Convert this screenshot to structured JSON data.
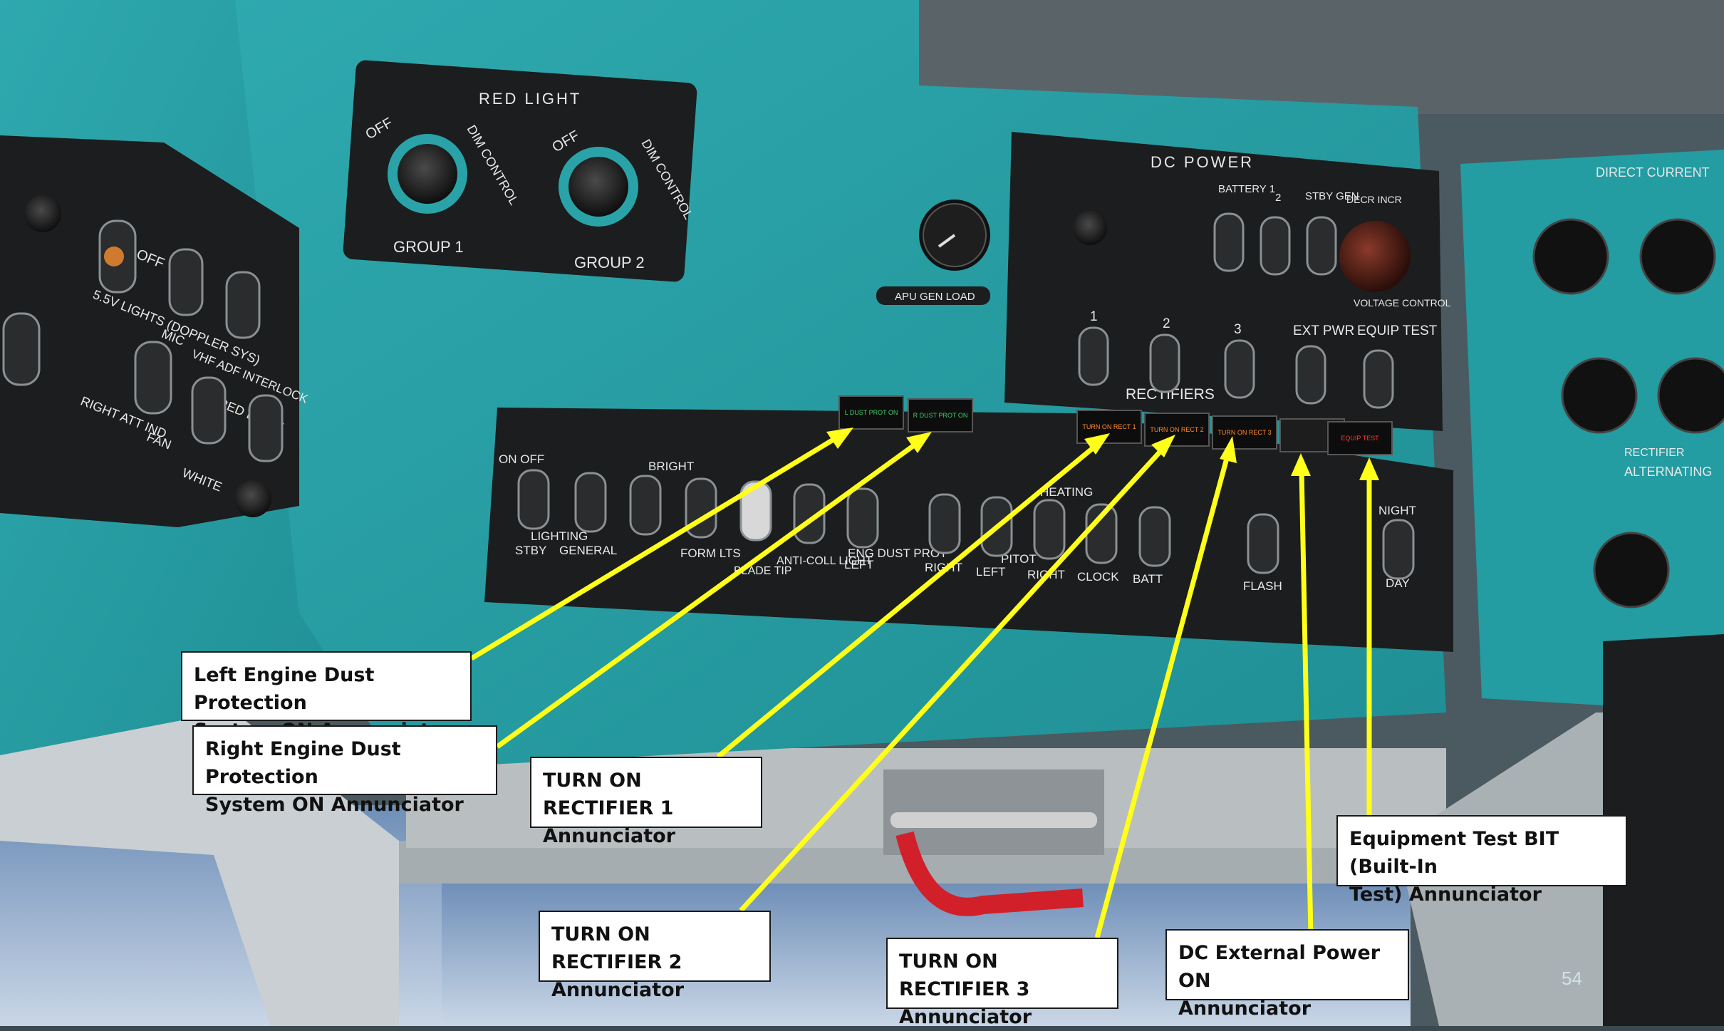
{
  "panel_labels": {
    "red_light": "RED LIGHT",
    "group1": "GROUP 1",
    "group2": "GROUP 2",
    "off": "OFF",
    "dim_control": "DIM CONTROL",
    "dc_power": "DC POWER",
    "rectifiers": "RECTIFIERS",
    "apu_gen_load": "APU GEN LOAD",
    "direct_current": "DIRECT CURRENT",
    "alternating": "ALTERNATING",
    "rectifier": "RECTIFIER",
    "battery_1": "BATTERY 1",
    "battery_2": "2",
    "stby_gen": "STBY GEN",
    "voltage_control": "VOLTAGE CONTROL",
    "decr_incr": "DECR INCR",
    "ext_pwr": "EXT PWR",
    "equip_test": "EQUIP TEST",
    "rect_1": "1",
    "rect_2": "2",
    "rect_3": "3",
    "on_off": "ON OFF",
    "lights_55v": "5.5V LIGHTS (DOPPLER SYS)",
    "mic": "MIC",
    "vhf_adf": "VHF ADF INTERLOCK",
    "right_att_ind": "RIGHT ATT IND",
    "fan": "FAN",
    "red_dome": "RED DOME",
    "white": "WHITE",
    "lighting": "LIGHTING",
    "stby": "STBY",
    "general": "GENERAL",
    "bright": "BRIGHT",
    "form_lts": "FORM LTS",
    "blade_tip": "BLADE TIP",
    "anti_coll": "ANTI-COLL LIGHT",
    "eng_dust_prot": "ENG DUST PROT",
    "left": "LEFT",
    "right": "RIGHT",
    "heating": "HEATING",
    "pitot": "PITOT",
    "clock": "CLOCK",
    "batt": "BATT",
    "flash": "FLASH",
    "night": "NIGHT",
    "day": "DAY"
  },
  "annunciators": {
    "l_dust": "L DUST PROT ON",
    "r_dust": "R DUST PROT ON",
    "rect1": "TURN ON RECT 1",
    "rect2": "TURN ON RECT 2",
    "rect3": "TURN ON RECT 3",
    "ext_pwr": "",
    "equip_test": "EQUIP TEST"
  },
  "callouts": {
    "left_dust": "Left Engine Dust Protection\nSystem ON Annunciator",
    "right_dust": "Right Engine Dust Protection\nSystem ON Annunciator",
    "rect1": "TURN ON RECTIFIER 1\nAnnunciator",
    "rect2": "TURN ON RECTIFIER 2\nAnnunciator",
    "rect3": "TURN ON RECTIFIER 3\nAnnunciator",
    "dc_ext": "DC External Power ON\nAnnunciator",
    "equip_test": "Equipment Test BIT (Built-In\nTest) Annunciator"
  },
  "page_number": "54",
  "colors": {
    "panel_teal": "#2aa3a8",
    "panel_black": "#1b1d1e",
    "arrow_yellow": "#ffff1a",
    "annunciator_green": "#3fd06a",
    "annunciator_amber": "#ff8a2a",
    "annunciator_red": "#ff3a2a"
  }
}
